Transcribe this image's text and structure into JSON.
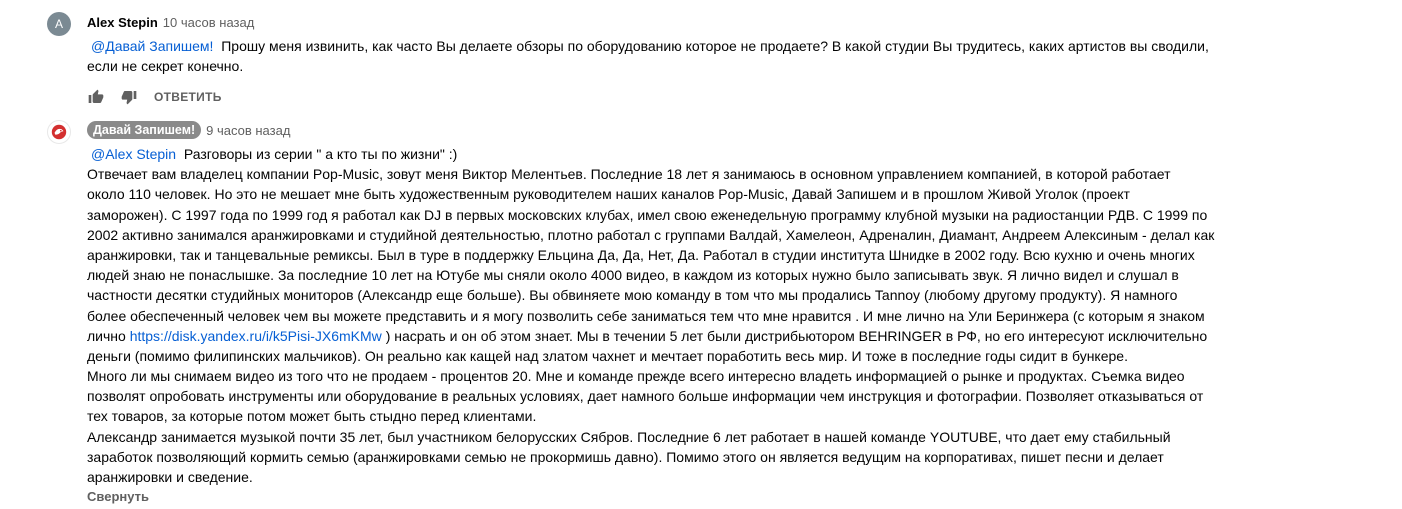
{
  "comment1": {
    "avatar_letter": "A",
    "author": "Alex Stepin",
    "time": "10 часов назад",
    "mention": "@Давай Запишем!",
    "text_line1": "Прошу меня извинить, как часто Вы делаете обзоры по оборудованию которое не продаете? В какой студии Вы трудитесь, каких артистов вы сводили,",
    "text_line2": "если не секрет конечно.",
    "reply_label": "ОТВЕТИТЬ"
  },
  "comment2": {
    "author": "Давай Запишем!",
    "time": "9 часов назад",
    "mention": "@Alex Stepin",
    "first_line_rest": "Разговоры из серии \" а кто ты по жизни\" :)",
    "lines": [
      "Отвечает вам владелец компании Pop-Music, зовут меня Виктор Мелентьев.  Последние 18 лет я занимаюсь в основном управлением компанией, в которой работает",
      "около 110 человек. Но это не мешает мне быть художественным руководителем наших каналов Pop-Music, Давай Запишем и в прошлом Живой Уголок (проект",
      "заморожен). С 1997 года по 1999 год я работал как DJ в первых московских клубах, имел свою еженедельную программу клубной музыки на радиостанции РДВ. С 1999 по",
      "2002 активно занимался аранжировками и студийной деятельностью, плотно работал с группами Валдай, Хамелеон, Адреналин, Диамант, Андреем Алексиным - делал как",
      "аранжировки, так и танцевальные ремиксы. Был в туре в поддержку Ельцина Да, Да, Нет, Да. Работал в студии института Шнидке в 2002 году. Всю кухню и очень многих",
      "людей знаю не понаслышке. За последние 10 лет на Ютубе мы сняли около 4000 видео, в каждом из которых нужно было записывать звук. Я лично видел  и слушал в",
      "частности десятки студийных мониторов (Александр еще больше).  Вы обвиняете мою команду в том что мы продались Tannoy (любому другому продукту). Я намного",
      "более обеспеченный человек чем вы можете представить и я могу позволить себе заниматься тем что мне нравится . И мне лично на Ули Беринжера (с которым я знаком"
    ],
    "link_line_before": "лично",
    "link_text": "https://disk.yandex.ru/i/k5Pisi-JX6mKMw",
    "link_line_after": ") насрать и он об этом знает. Мы в течении 5 лет были дистрибьютором BEHRINGER в РФ, но его интересуют исключительно",
    "lines_after": [
      "деньги (помимо филипинских мальчиков).  Он реально как кащей над златом чахнет и мечтает поработить весь мир. И тоже в последние годы сидит в бункере.",
      "Много ли мы снимаем видео из того что не продаем  - процентов 20. Мне и команде прежде всего интересно владеть информацией о рынке и продуктах. Съемка видео",
      "позволят опробовать инструменты или оборудование в реальных условиях, дает намного больше информации  чем инструкция и фотографии. Позволяет отказываться от",
      "тех товаров, за которые потом может быть стыдно перед клиентами.",
      "Александр занимается музыкой почти 35 лет, был участником белорусских Сябров. Последние 6 лет работает в нашей команде YOUTUBE, что дает ему стабильный",
      "заработок позволяющий кормить семью (аранжировками семью не прокормишь давно).  Помимо этого он является ведущим на корпоративах,  пишет песни и делает",
      "аранжировки и сведение."
    ],
    "collapse_label": "Свернуть"
  },
  "icons": {
    "like": "thumbs-up-icon",
    "dislike": "thumbs-down-icon",
    "brand_avatar": "brand-logo-icon"
  },
  "colors": {
    "link": "#065fd4",
    "secondary_text": "#606060",
    "badge_bg": "#8a8a8a",
    "avatar_a": "#7b8a93",
    "brand_red": "#d32f2f"
  }
}
